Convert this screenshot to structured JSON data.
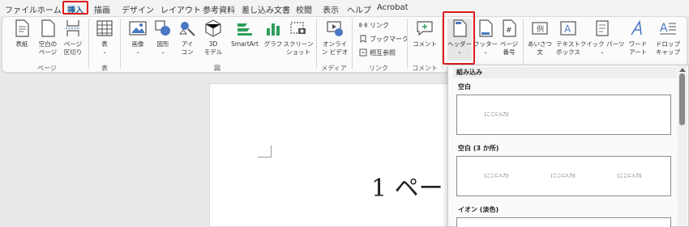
{
  "tabs": [
    "ファイル",
    "ホーム",
    "挿入",
    "描画",
    "デザイン",
    "レイアウト",
    "参考資料",
    "差し込み文書",
    "校閲",
    "表示",
    "ヘルプ",
    "Acrobat"
  ],
  "active_tab": "挿入",
  "ribbon": {
    "groups": [
      "ページ",
      "表",
      "図",
      "メディア",
      "リンク",
      "コメント"
    ],
    "page": {
      "cover": "表紙",
      "blank": [
        "空白の",
        "ページ"
      ],
      "break": [
        "ページ",
        "区切り"
      ]
    },
    "table": {
      "label": "表"
    },
    "illust": {
      "picture": "画像",
      "shapes": "図形",
      "icons": [
        "アイ",
        "コン"
      ],
      "model3d": [
        "3D",
        "モデル"
      ],
      "smartart": "SmartArt",
      "chart": "グラフ",
      "screenshot": [
        "スクリーン",
        "ショット"
      ]
    },
    "media": {
      "video": [
        "オンライ",
        "ン ビデオ"
      ]
    },
    "links": {
      "link": "リンク",
      "bookmark": "ブックマーク",
      "crossref": "相互参照"
    },
    "comments": {
      "comment": "コメント"
    },
    "header_footer": {
      "header": "ヘッダー",
      "footer": "フッター",
      "page_number": [
        "ページ",
        "番号"
      ]
    },
    "text": {
      "greeting": [
        "あいさつ",
        "文"
      ],
      "textbox": [
        "テキスト",
        "ボックス"
      ],
      "quickparts": "クイック パーツ",
      "wordart": [
        "ワード",
        "アート"
      ],
      "dropcap": [
        "ドロップ",
        "キャップ"
      ]
    }
  },
  "document": {
    "text": "1 ペー"
  },
  "dropdown": {
    "category": "組み込み",
    "items": [
      {
        "title": "空白",
        "placeholders": [
          "[ここに入力]"
        ]
      },
      {
        "title": "空白 (3 か所)",
        "placeholders": [
          "[ここに入力]",
          "[ここに入力]",
          "[ここに入力]"
        ]
      },
      {
        "title": "イオン (淡色)",
        "placeholders": []
      }
    ]
  },
  "colors": {
    "highlight": "#e01a1a",
    "accent": "#1a5c9c"
  }
}
